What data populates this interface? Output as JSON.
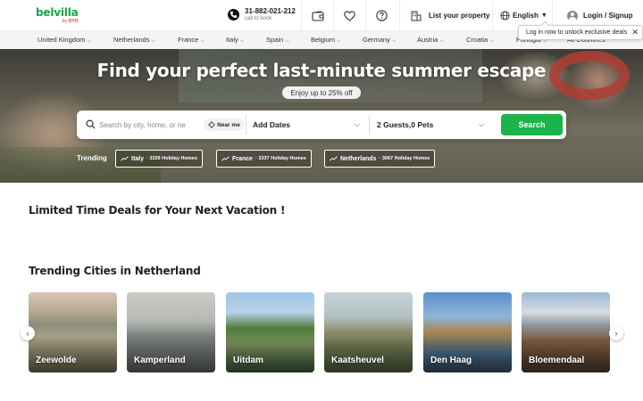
{
  "header": {
    "logo": {
      "name": "belvilla",
      "sub_prefix": "by",
      "sub_brand": "OYO"
    },
    "phone": {
      "number": "31-882-021-212",
      "label": "call to book"
    },
    "icons": [
      "wallet-icon",
      "heart-icon",
      "help-icon"
    ],
    "list_property": "List your property",
    "language": "English",
    "login": "Login / Signup"
  },
  "country_nav": {
    "items": [
      "United Kingdom",
      "Netherlands",
      "France",
      "Italy",
      "Spain",
      "Belgium",
      "Germany",
      "Austria",
      "Croatia",
      "Portugal",
      "All Countries"
    ]
  },
  "tooltip": {
    "text": "Log in now to unlock exclusive deals",
    "close": "✕"
  },
  "hero": {
    "title": "Find your perfect last-minute summer escape",
    "promo": "Enjoy up to 25% off"
  },
  "search": {
    "placeholder": "Search by city, home, or ne",
    "near_me": "Near me",
    "dates": "Add Dates",
    "guests": "2 Guests,0 Pets",
    "button": "Search"
  },
  "trending": {
    "label": "Trending",
    "chips": [
      {
        "name": "Italy",
        "count": "· 3329 Holiday Homes"
      },
      {
        "name": "France",
        "count": "· 3337 Holiday Homes"
      },
      {
        "name": "Netherlands",
        "count": "· 3067 Holiday Homes"
      }
    ]
  },
  "deals": {
    "title": "Limited Time Deals for Your Next Vacation !"
  },
  "cities": {
    "title": "Trending Cities in Netherland",
    "items": [
      "Zeewolde",
      "Kamperland",
      "Uitdam",
      "Kaatsheuvel",
      "Den Haag",
      "Bloemendaal"
    ]
  },
  "colors": {
    "brand_green": "#1bb34a",
    "logo_red": "#e53935"
  }
}
